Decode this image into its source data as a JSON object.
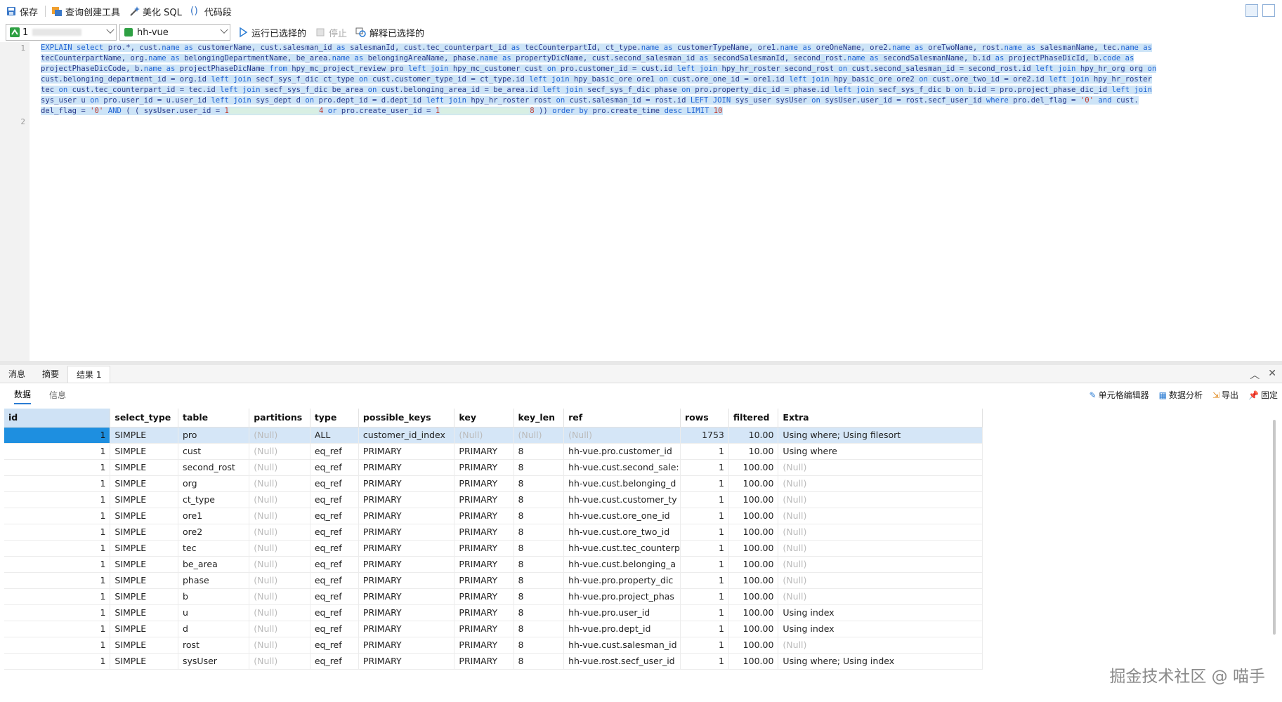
{
  "toolbar": {
    "save_label": "保存",
    "query_builder_label": "查询创建工具",
    "beautify_label": "美化 SQL",
    "snippet_label": "代码段"
  },
  "toolbar2": {
    "connection_value": "1",
    "database_value": "hh-vue",
    "run_selected_label": "运行已选择的",
    "stop_label": "停止",
    "explain_selected_label": "解释已选择的"
  },
  "editor": {
    "line_numbers": [
      "1",
      "2"
    ],
    "sql": {
      "t1": "EXPLAIN",
      "t2": "select",
      "t3": " pro.*, cust.",
      "t4": "name",
      "t5": "as",
      "t6": " customerName, cust.salesman_id ",
      "t7": "as",
      "t8": " salesmanId, cust.tec_counterpart_id ",
      "t9": "as",
      "t10": " tecCounterpartId, ct_type.",
      "t11": "name",
      "t12": "as",
      "t13": " customerTypeName, ore1.",
      "t14": "name",
      "t15": "as",
      "t16": " oreOneName, ore2.",
      "t17": "name",
      "t18": "as",
      "t19": " oreTwoName, rost.",
      "t20": "name",
      "t21": "as",
      "t22": " salesmanName, tec.",
      "t23": "name",
      "t24": "as",
      "l2a": "tecCounterpartName, org.",
      "l2b": "name",
      "l2c": "as",
      "l2d": " belongingDepartmentName, be_area.",
      "l2e": "name",
      "l2f": "as",
      "l2g": " belongingAreaName, phase.",
      "l2h": "name",
      "l2i": "as",
      "l2j": " propertyDicName, cust.second_salesman_id ",
      "l2k": "as",
      "l2l": " secondSalesmanId, second_rost.",
      "l2m": "name",
      "l2n": "as",
      "l2o": " secondSalesmanName, b.id ",
      "l2p": "as",
      "l2q": " projectPhaseDicId, b.",
      "l2r": "code",
      "l2s": "as",
      "l3a": "projectPhaseDicCode, b.",
      "l3b": "name",
      "l3c": "as",
      "l3d": " projectPhaseDicName ",
      "l3e": "from",
      "l3f": " hpy_mc_project_review pro ",
      "l3g": "left join",
      "l3h": " hpy_mc_customer cust ",
      "l3i": "on",
      "l3j": " pro.customer_id = cust.id ",
      "l3k": "left join",
      "l3l": " hpy_hr_roster second_rost ",
      "l3m": "on",
      "l3n": " cust.second_salesman_id = second_rost.id ",
      "l3o": "left join",
      "l3p": " hpy_hr_org org ",
      "l3q": "on",
      "l4a": "cust.belonging_department_id = org.id ",
      "l4b": "left join",
      "l4c": " secf_sys_f_dic ct_type ",
      "l4d": "on",
      "l4e": " cust.customer_type_id = ct_type.id ",
      "l4f": "left join",
      "l4g": " hpy_basic_ore ore1 ",
      "l4h": "on",
      "l4i": " cust.ore_one_id = ore1.id ",
      "l4j": "left join",
      "l4k": " hpy_basic_ore ore2 ",
      "l4l": "on",
      "l4m": " cust.ore_two_id = ore2.id ",
      "l4n": "left join",
      "l4o": " hpy_hr_roster",
      "l5a": "tec ",
      "l5b": "on",
      "l5c": " cust.tec_counterpart_id = tec.id ",
      "l5d": "left join",
      "l5e": " secf_sys_f_dic be_area ",
      "l5f": "on",
      "l5g": " cust.belonging_area_id = be_area.id ",
      "l5h": "left join",
      "l5i": " secf_sys_f_dic phase ",
      "l5j": "on",
      "l5k": " pro.property_dic_id = phase.id ",
      "l5l": "left join",
      "l5m": " secf_sys_f_dic b ",
      "l5n": "on",
      "l5o": " b.id = pro.project_phase_dic_id ",
      "l5p": "left join",
      "l6a": "sys_user u ",
      "l6b": "on",
      "l6c": " pro.user_id = u.user_id ",
      "l6d": "left join",
      "l6e": " sys_dept d ",
      "l6f": "on",
      "l6g": " pro.dept_id = d.dept_id ",
      "l6h": "left join",
      "l6i": " hpy_hr_roster rost ",
      "l6j": "on",
      "l6k": " cust.salesman_id = rost.id ",
      "l6l": "LEFT JOIN",
      "l6m": " sys_user sysUser ",
      "l6n": "on",
      "l6o": " sysUser.user_id = rost.secf_user_id ",
      "l6p": "where",
      "l6q": " pro.del_flag = ",
      "l6r": "'0'",
      "l6s": "and",
      "l6t": " cust.",
      "l7a": "del_flag = ",
      "l7b": "'0'",
      "l7c": "AND",
      "l7d": " ( ( sysUser.user_id = ",
      "l7e": "1",
      "l7f": "4",
      "l7g": "or",
      "l7h": " pro.create_user_id = ",
      "l7i": "1",
      "l7j": "8",
      "l7k": " )) ",
      "l7l": "order by",
      "l7m": " pro.create_time ",
      "l7n": "desc",
      "l7o": "LIMIT",
      "l7p": "10"
    }
  },
  "result_tabs": [
    "消息",
    "摘要",
    "结果 1"
  ],
  "sub_tabs": [
    "数据",
    "信息"
  ],
  "right_tools": [
    "单元格编辑器",
    "数据分析",
    "导出",
    "固定"
  ],
  "grid": {
    "columns": [
      "id",
      "select_type",
      "table",
      "partitions",
      "type",
      "possible_keys",
      "key",
      "key_len",
      "ref",
      "rows",
      "filtered",
      "Extra"
    ],
    "rows": [
      [
        "1",
        "SIMPLE",
        "pro",
        "(Null)",
        "ALL",
        "customer_id_index",
        "(Null)",
        "(Null)",
        "(Null)",
        "1753",
        "10.00",
        "Using where; Using filesort"
      ],
      [
        "1",
        "SIMPLE",
        "cust",
        "(Null)",
        "eq_ref",
        "PRIMARY",
        "PRIMARY",
        "8",
        "hh-vue.pro.customer_id",
        "1",
        "10.00",
        "Using where"
      ],
      [
        "1",
        "SIMPLE",
        "second_rost",
        "(Null)",
        "eq_ref",
        "PRIMARY",
        "PRIMARY",
        "8",
        "hh-vue.cust.second_sale:",
        "1",
        "100.00",
        "(Null)"
      ],
      [
        "1",
        "SIMPLE",
        "org",
        "(Null)",
        "eq_ref",
        "PRIMARY",
        "PRIMARY",
        "8",
        "hh-vue.cust.belonging_d",
        "1",
        "100.00",
        "(Null)"
      ],
      [
        "1",
        "SIMPLE",
        "ct_type",
        "(Null)",
        "eq_ref",
        "PRIMARY",
        "PRIMARY",
        "8",
        "hh-vue.cust.customer_ty",
        "1",
        "100.00",
        "(Null)"
      ],
      [
        "1",
        "SIMPLE",
        "ore1",
        "(Null)",
        "eq_ref",
        "PRIMARY",
        "PRIMARY",
        "8",
        "hh-vue.cust.ore_one_id",
        "1",
        "100.00",
        "(Null)"
      ],
      [
        "1",
        "SIMPLE",
        "ore2",
        "(Null)",
        "eq_ref",
        "PRIMARY",
        "PRIMARY",
        "8",
        "hh-vue.cust.ore_two_id",
        "1",
        "100.00",
        "(Null)"
      ],
      [
        "1",
        "SIMPLE",
        "tec",
        "(Null)",
        "eq_ref",
        "PRIMARY",
        "PRIMARY",
        "8",
        "hh-vue.cust.tec_counterp",
        "1",
        "100.00",
        "(Null)"
      ],
      [
        "1",
        "SIMPLE",
        "be_area",
        "(Null)",
        "eq_ref",
        "PRIMARY",
        "PRIMARY",
        "8",
        "hh-vue.cust.belonging_a",
        "1",
        "100.00",
        "(Null)"
      ],
      [
        "1",
        "SIMPLE",
        "phase",
        "(Null)",
        "eq_ref",
        "PRIMARY",
        "PRIMARY",
        "8",
        "hh-vue.pro.property_dic",
        "1",
        "100.00",
        "(Null)"
      ],
      [
        "1",
        "SIMPLE",
        "b",
        "(Null)",
        "eq_ref",
        "PRIMARY",
        "PRIMARY",
        "8",
        "hh-vue.pro.project_phas",
        "1",
        "100.00",
        "(Null)"
      ],
      [
        "1",
        "SIMPLE",
        "u",
        "(Null)",
        "eq_ref",
        "PRIMARY",
        "PRIMARY",
        "8",
        "hh-vue.pro.user_id",
        "1",
        "100.00",
        "Using index"
      ],
      [
        "1",
        "SIMPLE",
        "d",
        "(Null)",
        "eq_ref",
        "PRIMARY",
        "PRIMARY",
        "8",
        "hh-vue.pro.dept_id",
        "1",
        "100.00",
        "Using index"
      ],
      [
        "1",
        "SIMPLE",
        "rost",
        "(Null)",
        "eq_ref",
        "PRIMARY",
        "PRIMARY",
        "8",
        "hh-vue.cust.salesman_id",
        "1",
        "100.00",
        "(Null)"
      ],
      [
        "1",
        "SIMPLE",
        "sysUser",
        "(Null)",
        "eq_ref",
        "PRIMARY",
        "PRIMARY",
        "8",
        "hh-vue.rost.secf_user_id",
        "1",
        "100.00",
        "Using where; Using index"
      ]
    ]
  },
  "watermark": "掘金技术社区 @ 喵手",
  "colors": {
    "keyword": "#1f62d3",
    "selection": "#cde4f7",
    "selected_cell": "#1e8fe0",
    "null_text": "#bbbbbb"
  }
}
